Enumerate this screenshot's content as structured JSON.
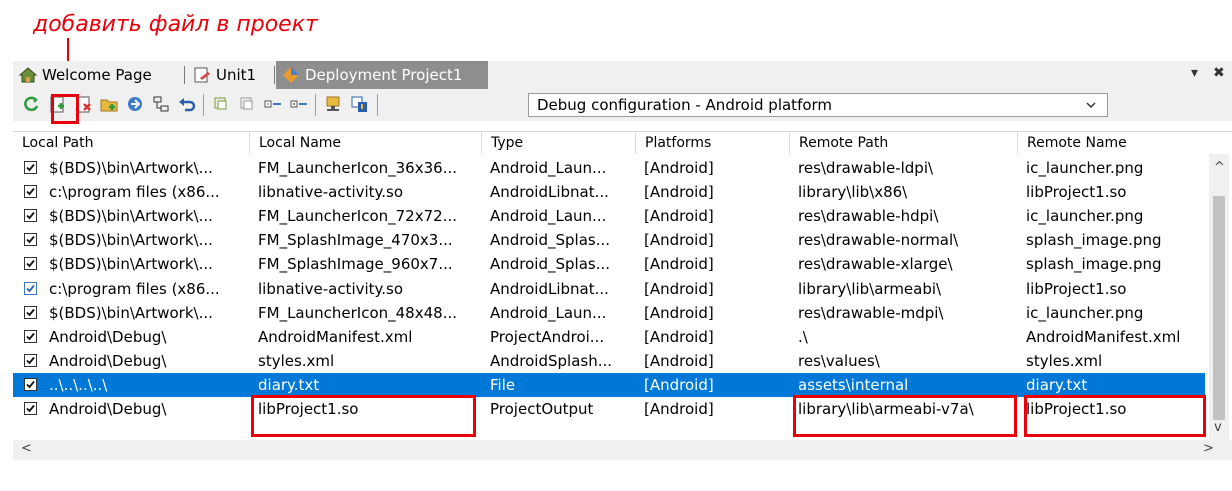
{
  "annotation": {
    "text": "добавить файл в проект",
    "color": "#e8000b"
  },
  "tabs": [
    {
      "label": "Welcome Page",
      "icon": "home-icon",
      "active": false
    },
    {
      "label": "Unit1",
      "icon": "unit-file-icon",
      "active": false
    },
    {
      "label": "Deployment Project1",
      "icon": "deployment-diamond-icon",
      "active": true
    }
  ],
  "window_controls": {
    "menu": "▾",
    "close": "✖"
  },
  "toolbar": {
    "buttons": [
      "revert-to-default-icon",
      "add-files-icon",
      "remove-files-icon",
      "add-feature-files-icon",
      "deploy-icon",
      "connect-icon",
      "undo-icon",
      "copy-icon",
      "copy-alt-icon",
      "collapse-icon",
      "expand-icon",
      "folder-icon",
      "export-icon"
    ],
    "configuration": "Debug configuration - Android platform"
  },
  "columns": [
    "Local Path",
    "Local Name",
    "Type",
    "Platforms",
    "Remote Path",
    "Remote Name"
  ],
  "rows": [
    {
      "checked": true,
      "local_path": "$(BDS)\\bin\\Artwork\\...",
      "local_name": "FM_LauncherIcon_36x36...",
      "type": "Android_Laun...",
      "platforms": "[Android]",
      "remote_path": "res\\drawable-ldpi\\",
      "remote_name": "ic_launcher.png"
    },
    {
      "checked": true,
      "local_path": "c:\\program files (x86...",
      "local_name": "libnative-activity.so",
      "type": "AndroidLibnat...",
      "platforms": "[Android]",
      "remote_path": "library\\lib\\x86\\",
      "remote_name": "libProject1.so"
    },
    {
      "checked": true,
      "local_path": "$(BDS)\\bin\\Artwork\\...",
      "local_name": "FM_LauncherIcon_72x72...",
      "type": "Android_Laun...",
      "platforms": "[Android]",
      "remote_path": "res\\drawable-hdpi\\",
      "remote_name": "ic_launcher.png"
    },
    {
      "checked": true,
      "local_path": "$(BDS)\\bin\\Artwork\\...",
      "local_name": "FM_SplashImage_470x3...",
      "type": "Android_Splas...",
      "platforms": "[Android]",
      "remote_path": "res\\drawable-normal\\",
      "remote_name": "splash_image.png"
    },
    {
      "checked": true,
      "local_path": "$(BDS)\\bin\\Artwork\\...",
      "local_name": "FM_SplashImage_960x7...",
      "type": "Android_Splas...",
      "platforms": "[Android]",
      "remote_path": "res\\drawable-xlarge\\",
      "remote_name": "splash_image.png"
    },
    {
      "checked": true,
      "blue_check": true,
      "local_path": "c:\\program files (x86...",
      "local_name": "libnative-activity.so",
      "type": "AndroidLibnat...",
      "platforms": "[Android]",
      "remote_path": "library\\lib\\armeabi\\",
      "remote_name": "libProject1.so"
    },
    {
      "checked": true,
      "local_path": "$(BDS)\\bin\\Artwork\\...",
      "local_name": "FM_LauncherIcon_48x48...",
      "type": "Android_Laun...",
      "platforms": "[Android]",
      "remote_path": "res\\drawable-mdpi\\",
      "remote_name": "ic_launcher.png"
    },
    {
      "checked": true,
      "local_path": "Android\\Debug\\",
      "local_name": "AndroidManifest.xml",
      "type": "ProjectAndroi...",
      "platforms": "[Android]",
      "remote_path": ".\\",
      "remote_name": "AndroidManifest.xml"
    },
    {
      "checked": true,
      "local_path": "Android\\Debug\\",
      "local_name": "styles.xml",
      "type": "AndroidSplash...",
      "platforms": "[Android]",
      "remote_path": "res\\values\\",
      "remote_name": "styles.xml"
    },
    {
      "checked": true,
      "selected": true,
      "local_path": "..\\..\\..\\..\\",
      "local_name": "diary.txt",
      "type": "File",
      "platforms": "[Android]",
      "remote_path": "assets\\internal",
      "remote_name": "diary.txt"
    },
    {
      "checked": true,
      "local_path": "Android\\Debug\\",
      "local_name": "libProject1.so",
      "type": "ProjectOutput",
      "platforms": "[Android]",
      "remote_path": "library\\lib\\armeabi-v7a\\",
      "remote_name": "libProject1.so"
    }
  ],
  "scroll": {
    "left": "<",
    "right": ">",
    "up": "^",
    "down": "v"
  },
  "colors": {
    "selection": "#0078d7",
    "highlight": "#e8000b"
  }
}
